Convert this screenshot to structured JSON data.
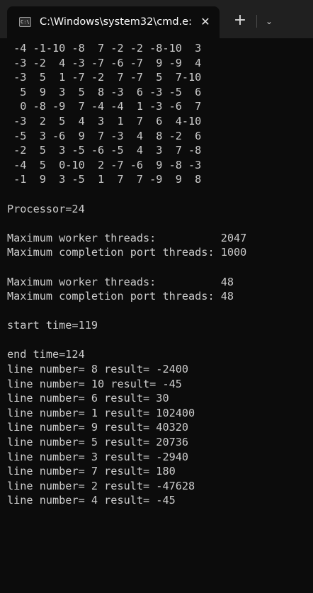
{
  "tab": {
    "icon_text": "C:\\",
    "title": "C:\\Windows\\system32\\cmd.e:",
    "close_glyph": "✕",
    "new_tab_glyph": "+",
    "dropdown_glyph": "⌄"
  },
  "console": {
    "lines": [
      " -4 -1-10 -8  7 -2 -2 -8-10  3",
      " -3 -2  4 -3 -7 -6 -7  9 -9  4",
      " -3  5  1 -7 -2  7 -7  5  7-10",
      "  5  9  3  5  8 -3  6 -3 -5  6",
      "  0 -8 -9  7 -4 -4  1 -3 -6  7",
      " -3  2  5  4  3  1  7  6  4-10",
      " -5  3 -6  9  7 -3  4  8 -2  6",
      " -2  5  3 -5 -6 -5  4  3  7 -8",
      " -4  5  0-10  2 -7 -6  9 -8 -3",
      " -1  9  3 -5  1  7  7 -9  9  8",
      "",
      "Processor=24",
      "",
      "Maximum worker threads:          2047",
      "Maximum completion port threads: 1000",
      "",
      "Maximum worker threads:          48",
      "Maximum completion port threads: 48",
      "",
      "start time=119",
      "",
      "end time=124",
      "line number= 8 result= -2400",
      "line number= 10 result= -45",
      "line number= 6 result= 30",
      "line number= 1 result= 102400",
      "line number= 9 result= 40320",
      "line number= 5 result= 20736",
      "line number= 3 result= -2940",
      "line number= 7 result= 180",
      "line number= 2 result= -47628",
      "line number= 4 result= -45"
    ]
  }
}
